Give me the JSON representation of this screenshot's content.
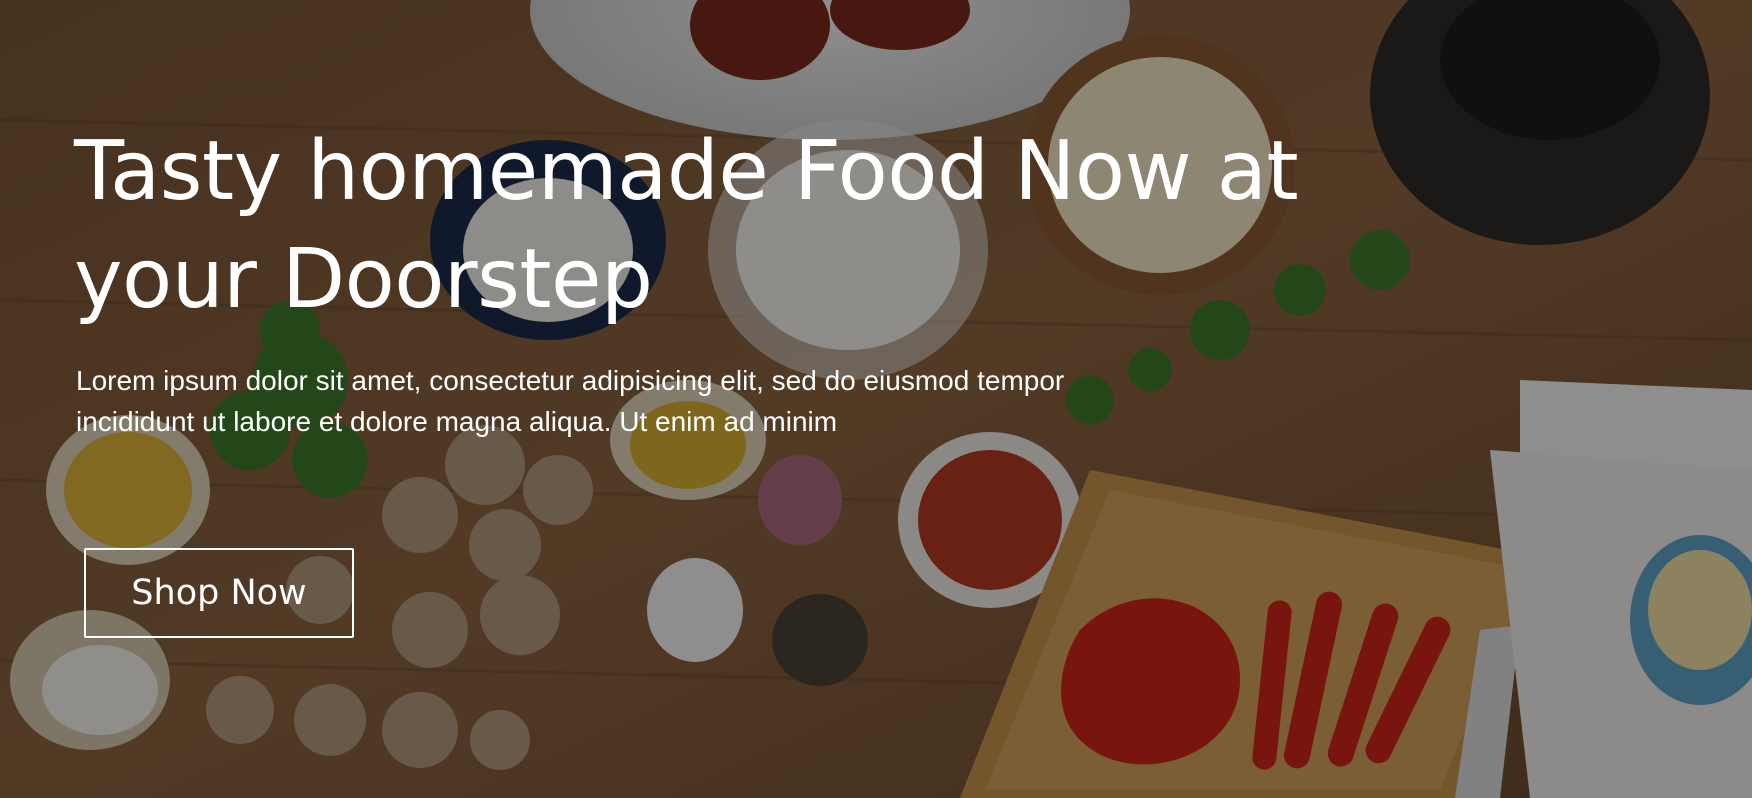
{
  "hero": {
    "title": "Tasty homemade Food Now at your Doorstep",
    "description": "Lorem ipsum dolor sit amet, consectetur adipisicing elit, sed do eiusmod tempor incididunt ut labore et dolore magna aliqua. Ut enim ad minim",
    "cta_label": "Shop Now",
    "background_image": "food-ingredients-on-wooden-table",
    "text_color": "#ffffff",
    "overlay_color": "#000000"
  }
}
